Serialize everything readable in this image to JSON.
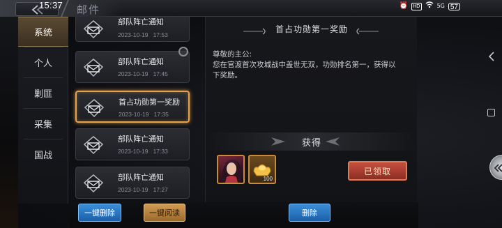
{
  "status_bar": {
    "time": "15:37",
    "icons": [
      "alarm-icon",
      "hd-icon",
      "wifi-icon",
      "signal-icon"
    ],
    "hd": "HD",
    "signal": "5G",
    "battery": "57"
  },
  "header": {
    "title": "邮件"
  },
  "sidebar": {
    "items": [
      {
        "label": "系统",
        "active": true
      },
      {
        "label": "个人",
        "active": false
      },
      {
        "label": "剿匪",
        "active": false
      },
      {
        "label": "采集",
        "active": false
      },
      {
        "label": "国战",
        "active": false
      }
    ]
  },
  "mail_list": {
    "items": [
      {
        "title": "部队阵亡通知",
        "date": "2023-10-19",
        "time": "17:53",
        "selected": false
      },
      {
        "title": "部队阵亡通知",
        "date": "2023-10-19",
        "time": "17:45",
        "selected": false
      },
      {
        "title": "首占功勋第一奖励",
        "date": "2023-10-19",
        "time": "17:35",
        "selected": true
      },
      {
        "title": "部队阵亡通知",
        "date": "2023-10-19",
        "time": "17:33",
        "selected": false
      },
      {
        "title": "部队阵亡通知",
        "date": "2023-10-19",
        "time": "17:27",
        "selected": false
      }
    ]
  },
  "detail": {
    "title": "首占功勋第一奖励",
    "greeting": "尊敬的主公:",
    "body": "您在官渡首次攻城战中盖世无双，功勋排名第一，获得以下奖励。",
    "reward_header": "获得",
    "rewards": [
      {
        "type": "hero-portrait",
        "quantity": ""
      },
      {
        "type": "gold-ingot",
        "quantity": "100"
      }
    ],
    "claimed_label": "已领取"
  },
  "actions": {
    "delete_all": "一键删除",
    "read_all": "一键阅读",
    "delete": "删除"
  },
  "colors": {
    "accent_gold": "#e7a24a",
    "button_blue": "#2a78c4",
    "claimed_red": "#b0402f"
  }
}
